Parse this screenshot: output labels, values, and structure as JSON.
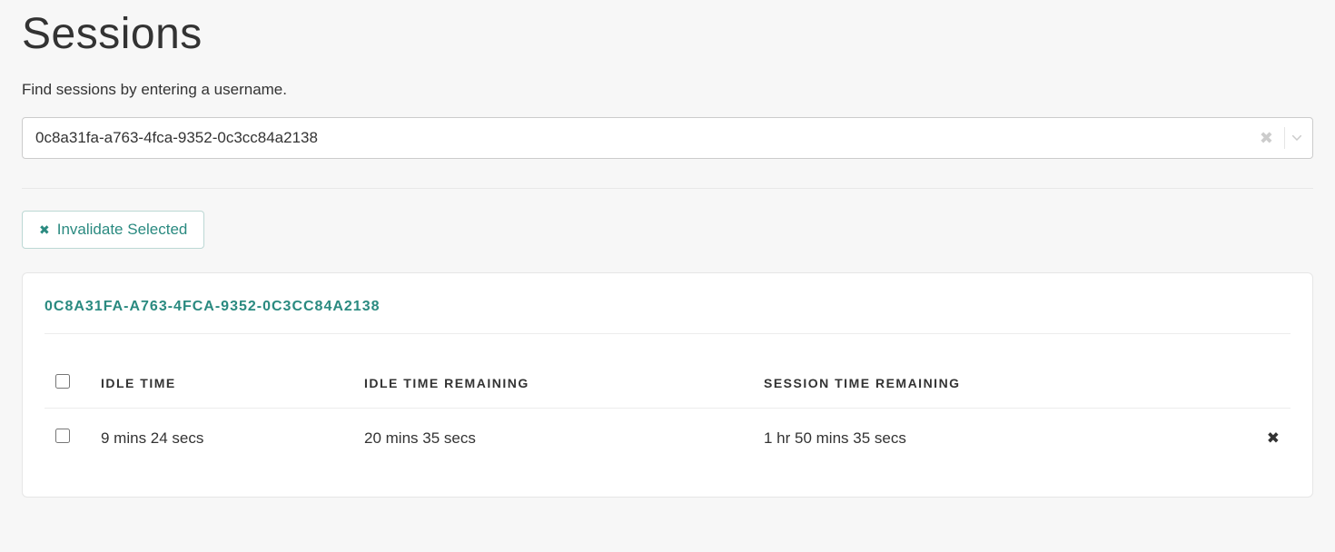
{
  "page": {
    "title": "Sessions",
    "subtitle": "Find sessions by entering a username."
  },
  "search": {
    "value": "0c8a31fa-a763-4fca-9352-0c3cc84a2138"
  },
  "actions": {
    "invalidate_selected": "Invalidate Selected"
  },
  "panel": {
    "user_id": "0C8A31FA-A763-4FCA-9352-0C3CC84A2138",
    "columns": {
      "idle_time": "IDLE TIME",
      "idle_time_remaining": "IDLE TIME REMAINING",
      "session_time_remaining": "SESSION TIME REMAINING"
    },
    "rows": [
      {
        "idle_time": "9 mins 24 secs",
        "idle_time_remaining": "20 mins 35 secs",
        "session_time_remaining": "1 hr 50 mins 35 secs"
      }
    ]
  }
}
